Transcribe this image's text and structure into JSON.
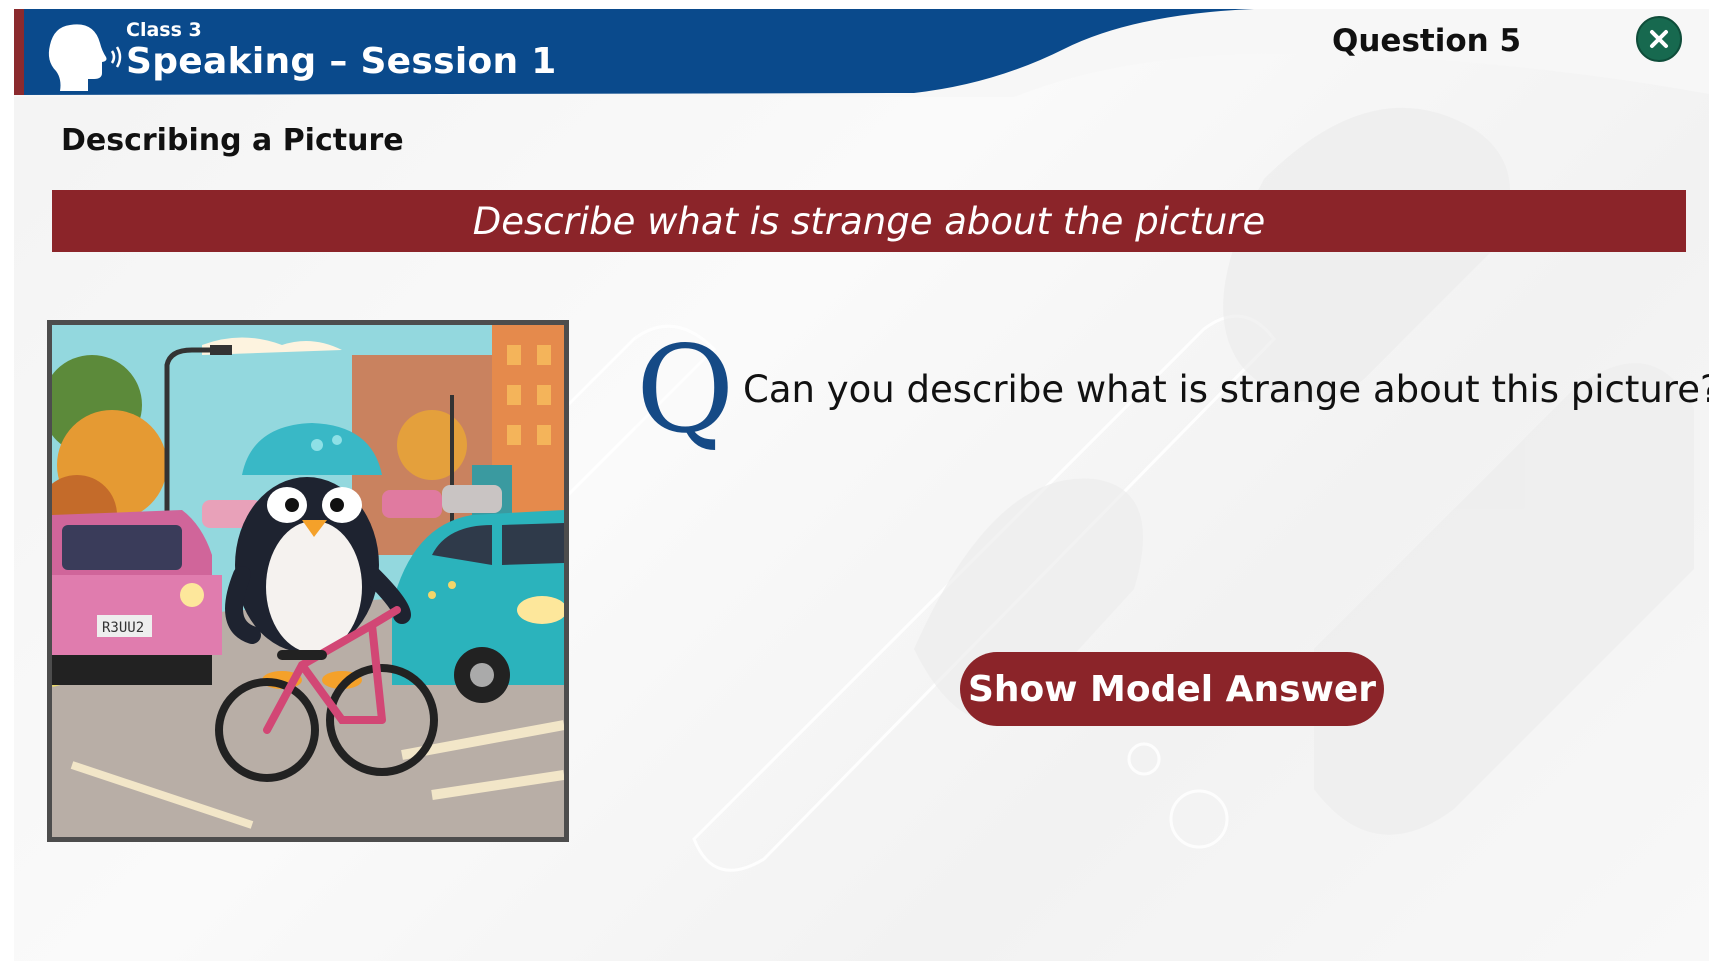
{
  "header": {
    "class_label": "Class 3",
    "session_title": "Speaking – Session 1",
    "question_label": "Question 5",
    "close_icon": "close-icon"
  },
  "section": {
    "title": "Describing a Picture"
  },
  "banner": {
    "instruction": "Describe what is strange about the picture"
  },
  "prompt": {
    "q_marker": "Q",
    "question": "Can you describe what is strange about this picture?"
  },
  "actions": {
    "show_model_answer": "Show Model Answer"
  },
  "picture": {
    "subject": "penguin riding a bicycle in city traffic",
    "plate_text": "R3UU2"
  },
  "colors": {
    "header_blue": "#0a4a8c",
    "accent_maroon": "#8b2429",
    "close_green": "#17694f",
    "q_blue": "#154a86"
  }
}
